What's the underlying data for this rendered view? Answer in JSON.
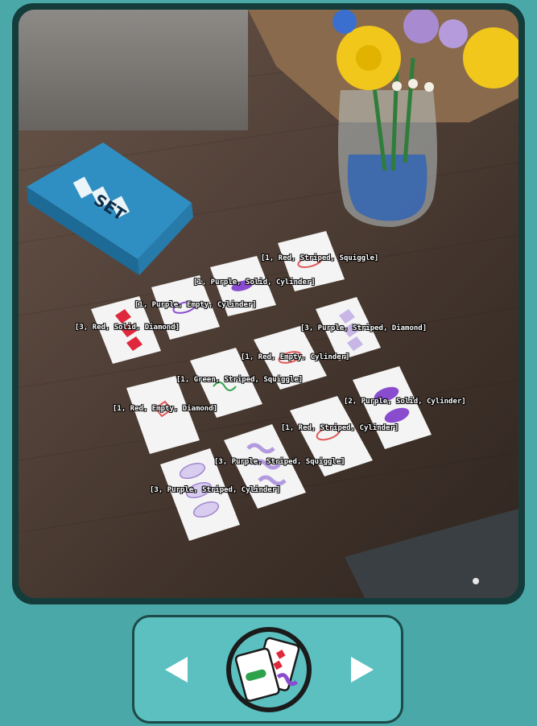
{
  "app": {
    "accent_color": "#4aa9a8",
    "frame_color": "#143c3a",
    "panel_color": "#5cc0c0"
  },
  "photo": {
    "box_text": "SET",
    "card_labels": [
      "[1, Red, Striped, Squiggle]",
      "[1, Purple, Solid, Cylinder]",
      "[1, Purple, Empty, Cylinder]",
      "[3, Red, Solid, Diamond]",
      "[3, Purple, Striped, Diamond]",
      "[1, Red, Empty, Cylinder]",
      "[1, Green, Striped, Squiggle]",
      "[2, Purple, Solid, Cylinder]",
      "[1, Red, Empty, Diamond]",
      "[1, Red, Striped, Cylinder]",
      "[3, Purple, Striped, Squiggle]",
      "[3, Purple, Striped, Cylinder]"
    ]
  },
  "nav": {
    "prev_icon": "triangle-left-icon",
    "next_icon": "triangle-right-icon",
    "logo_icon": "set-cards-logo-icon"
  }
}
